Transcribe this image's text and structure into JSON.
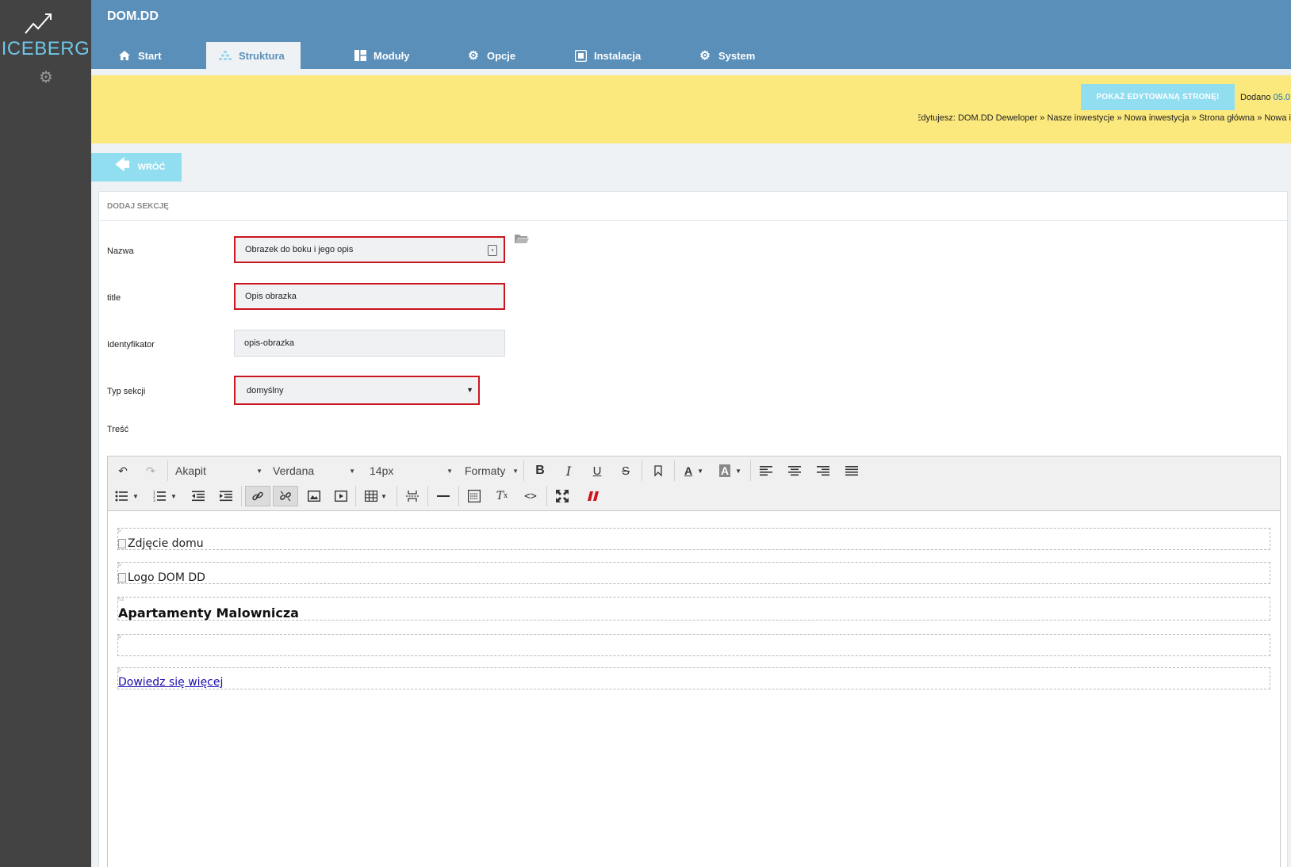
{
  "sidebar": {
    "logo_text": "ICEBERG",
    "icons": [
      "chart-line-icon",
      "gear-icon"
    ]
  },
  "header": {
    "title": "DOM.DD",
    "tabs": [
      {
        "label": "Start",
        "icon": "home-icon"
      },
      {
        "label": "Struktura",
        "icon": "structure-icon",
        "active": true
      },
      {
        "label": "Moduły",
        "icon": "modules-icon"
      },
      {
        "label": "Opcje",
        "icon": "gear-icon"
      },
      {
        "label": "Instalacja",
        "icon": "install-icon"
      },
      {
        "label": "System",
        "icon": "gear-icon"
      }
    ]
  },
  "notice": {
    "preview_button": "POKAŻ EDYTOWANĄ STRONĘ!",
    "added_label": "Dodano",
    "added_date": "05.0",
    "breadcrumb": "Edytujesz: DOM.DD Deweloper » Nasze inwestycje » Nowa inwestycja » Strona główna » Nowa i",
    "background_color": "#fbe97d",
    "button_color": "#91def0"
  },
  "back_button": "WRÓĆ",
  "panel": {
    "heading": "DODAJ SEKCJĘ",
    "fields": {
      "name": {
        "label": "Nazwa",
        "value": "Obrazek do boku i jego opis"
      },
      "title": {
        "label": "title",
        "value": "Opis obrazka"
      },
      "identifier": {
        "label": "Identyfikator",
        "value": "opis-obrazka"
      },
      "section_type": {
        "label": "Typ sekcji",
        "value": "domyślny"
      },
      "content": {
        "label": "Treść"
      }
    }
  },
  "editor": {
    "toolbar": {
      "format_select": "Akapit",
      "font_select": "Verdana",
      "size_select": "14px",
      "formats_select": "Formaty"
    },
    "content": {
      "tags": [
        "p",
        "p",
        "h2",
        "p",
        "p"
      ],
      "image1_alt": "Zdjęcie domu",
      "image2_alt": "Logo DOM DD",
      "heading": "Apartamenty Malownicza",
      "link": "Dowiedz się więcej"
    }
  },
  "colors": {
    "sidebar": "#434343",
    "header": "#5a8fba",
    "accent": "#6fc6e8",
    "error_border": "#c9151e"
  }
}
